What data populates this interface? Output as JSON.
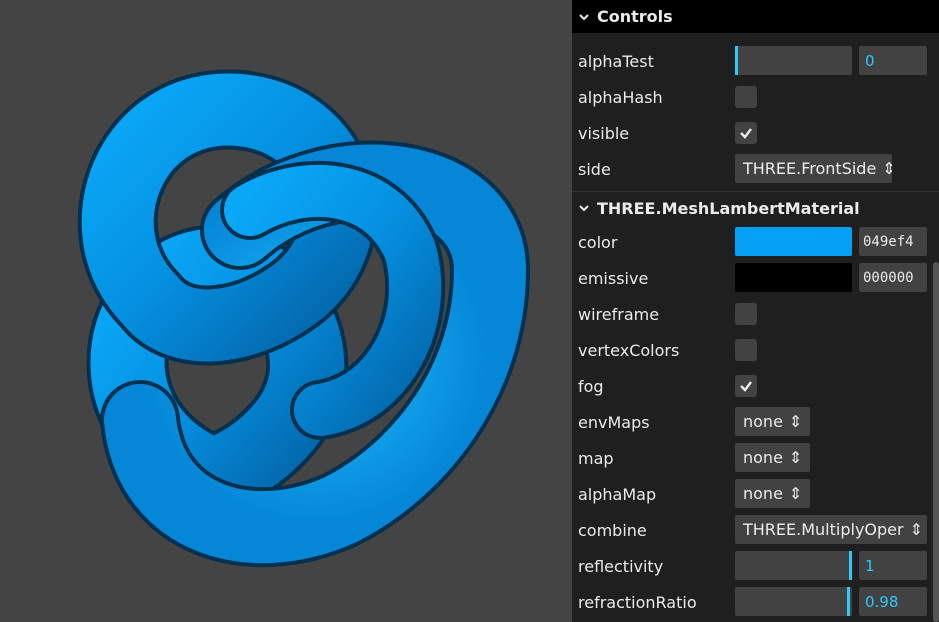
{
  "controls": {
    "title": "Controls",
    "rows": {
      "alphaTest": {
        "label": "alphaTest",
        "value": "0",
        "level": 0
      },
      "alphaHash": {
        "label": "alphaHash",
        "checked": false
      },
      "visible": {
        "label": "visible",
        "checked": true
      },
      "side": {
        "label": "side",
        "value": "THREE.FrontSide"
      }
    }
  },
  "material": {
    "title": "THREE.MeshLambertMaterial",
    "color": {
      "label": "color",
      "hex": "049ef4",
      "swatch": "#049ef4"
    },
    "emissive": {
      "label": "emissive",
      "hex": "000000",
      "swatch": "#000000"
    },
    "wireframe": {
      "label": "wireframe",
      "checked": false
    },
    "vertexColors": {
      "label": "vertexColors",
      "checked": false
    },
    "fog": {
      "label": "fog",
      "checked": true
    },
    "envMaps": {
      "label": "envMaps",
      "value": "none"
    },
    "map": {
      "label": "map",
      "value": "none"
    },
    "alphaMap": {
      "label": "alphaMap",
      "value": "none"
    },
    "combine": {
      "label": "combine",
      "value": "THREE.MultiplyOper"
    },
    "reflectivity": {
      "label": "reflectivity",
      "value": "1",
      "level": 1
    },
    "refractionRatio": {
      "label": "refractionRatio",
      "value": "0.98",
      "level": 0.98
    }
  },
  "colors": {
    "background": "#444444",
    "mesh": "#049ef4",
    "accent": "#2cc9ff"
  }
}
